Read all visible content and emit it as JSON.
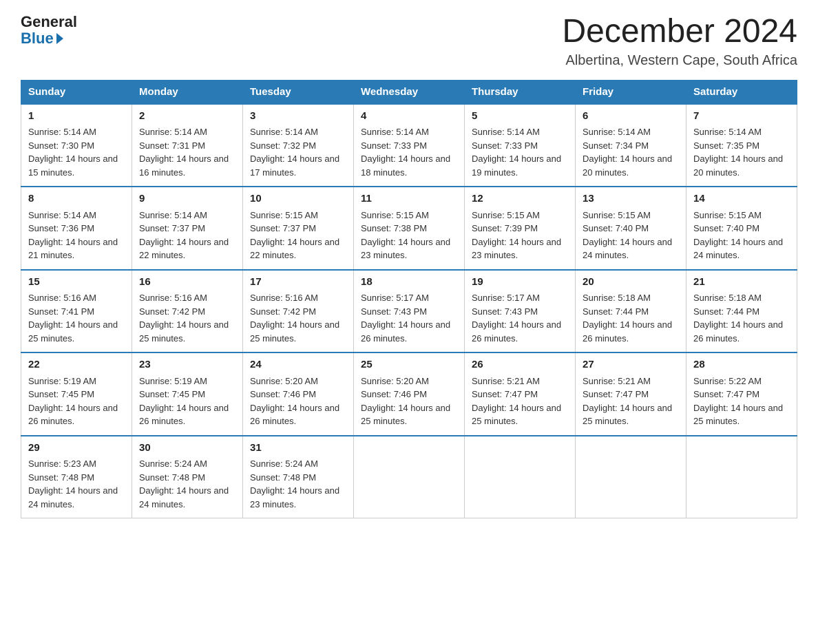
{
  "header": {
    "logo_line1": "General",
    "logo_line2": "Blue",
    "month_title": "December 2024",
    "location": "Albertina, Western Cape, South Africa"
  },
  "days_of_week": [
    "Sunday",
    "Monday",
    "Tuesday",
    "Wednesday",
    "Thursday",
    "Friday",
    "Saturday"
  ],
  "weeks": [
    [
      {
        "day": 1,
        "sunrise": "5:14 AM",
        "sunset": "7:30 PM",
        "daylight": "14 hours and 15 minutes."
      },
      {
        "day": 2,
        "sunrise": "5:14 AM",
        "sunset": "7:31 PM",
        "daylight": "14 hours and 16 minutes."
      },
      {
        "day": 3,
        "sunrise": "5:14 AM",
        "sunset": "7:32 PM",
        "daylight": "14 hours and 17 minutes."
      },
      {
        "day": 4,
        "sunrise": "5:14 AM",
        "sunset": "7:33 PM",
        "daylight": "14 hours and 18 minutes."
      },
      {
        "day": 5,
        "sunrise": "5:14 AM",
        "sunset": "7:33 PM",
        "daylight": "14 hours and 19 minutes."
      },
      {
        "day": 6,
        "sunrise": "5:14 AM",
        "sunset": "7:34 PM",
        "daylight": "14 hours and 20 minutes."
      },
      {
        "day": 7,
        "sunrise": "5:14 AM",
        "sunset": "7:35 PM",
        "daylight": "14 hours and 20 minutes."
      }
    ],
    [
      {
        "day": 8,
        "sunrise": "5:14 AM",
        "sunset": "7:36 PM",
        "daylight": "14 hours and 21 minutes."
      },
      {
        "day": 9,
        "sunrise": "5:14 AM",
        "sunset": "7:37 PM",
        "daylight": "14 hours and 22 minutes."
      },
      {
        "day": 10,
        "sunrise": "5:15 AM",
        "sunset": "7:37 PM",
        "daylight": "14 hours and 22 minutes."
      },
      {
        "day": 11,
        "sunrise": "5:15 AM",
        "sunset": "7:38 PM",
        "daylight": "14 hours and 23 minutes."
      },
      {
        "day": 12,
        "sunrise": "5:15 AM",
        "sunset": "7:39 PM",
        "daylight": "14 hours and 23 minutes."
      },
      {
        "day": 13,
        "sunrise": "5:15 AM",
        "sunset": "7:40 PM",
        "daylight": "14 hours and 24 minutes."
      },
      {
        "day": 14,
        "sunrise": "5:15 AM",
        "sunset": "7:40 PM",
        "daylight": "14 hours and 24 minutes."
      }
    ],
    [
      {
        "day": 15,
        "sunrise": "5:16 AM",
        "sunset": "7:41 PM",
        "daylight": "14 hours and 25 minutes."
      },
      {
        "day": 16,
        "sunrise": "5:16 AM",
        "sunset": "7:42 PM",
        "daylight": "14 hours and 25 minutes."
      },
      {
        "day": 17,
        "sunrise": "5:16 AM",
        "sunset": "7:42 PM",
        "daylight": "14 hours and 25 minutes."
      },
      {
        "day": 18,
        "sunrise": "5:17 AM",
        "sunset": "7:43 PM",
        "daylight": "14 hours and 26 minutes."
      },
      {
        "day": 19,
        "sunrise": "5:17 AM",
        "sunset": "7:43 PM",
        "daylight": "14 hours and 26 minutes."
      },
      {
        "day": 20,
        "sunrise": "5:18 AM",
        "sunset": "7:44 PM",
        "daylight": "14 hours and 26 minutes."
      },
      {
        "day": 21,
        "sunrise": "5:18 AM",
        "sunset": "7:44 PM",
        "daylight": "14 hours and 26 minutes."
      }
    ],
    [
      {
        "day": 22,
        "sunrise": "5:19 AM",
        "sunset": "7:45 PM",
        "daylight": "14 hours and 26 minutes."
      },
      {
        "day": 23,
        "sunrise": "5:19 AM",
        "sunset": "7:45 PM",
        "daylight": "14 hours and 26 minutes."
      },
      {
        "day": 24,
        "sunrise": "5:20 AM",
        "sunset": "7:46 PM",
        "daylight": "14 hours and 26 minutes."
      },
      {
        "day": 25,
        "sunrise": "5:20 AM",
        "sunset": "7:46 PM",
        "daylight": "14 hours and 25 minutes."
      },
      {
        "day": 26,
        "sunrise": "5:21 AM",
        "sunset": "7:47 PM",
        "daylight": "14 hours and 25 minutes."
      },
      {
        "day": 27,
        "sunrise": "5:21 AM",
        "sunset": "7:47 PM",
        "daylight": "14 hours and 25 minutes."
      },
      {
        "day": 28,
        "sunrise": "5:22 AM",
        "sunset": "7:47 PM",
        "daylight": "14 hours and 25 minutes."
      }
    ],
    [
      {
        "day": 29,
        "sunrise": "5:23 AM",
        "sunset": "7:48 PM",
        "daylight": "14 hours and 24 minutes."
      },
      {
        "day": 30,
        "sunrise": "5:24 AM",
        "sunset": "7:48 PM",
        "daylight": "14 hours and 24 minutes."
      },
      {
        "day": 31,
        "sunrise": "5:24 AM",
        "sunset": "7:48 PM",
        "daylight": "14 hours and 23 minutes."
      },
      null,
      null,
      null,
      null
    ]
  ],
  "labels": {
    "sunrise": "Sunrise:",
    "sunset": "Sunset:",
    "daylight": "Daylight:"
  }
}
